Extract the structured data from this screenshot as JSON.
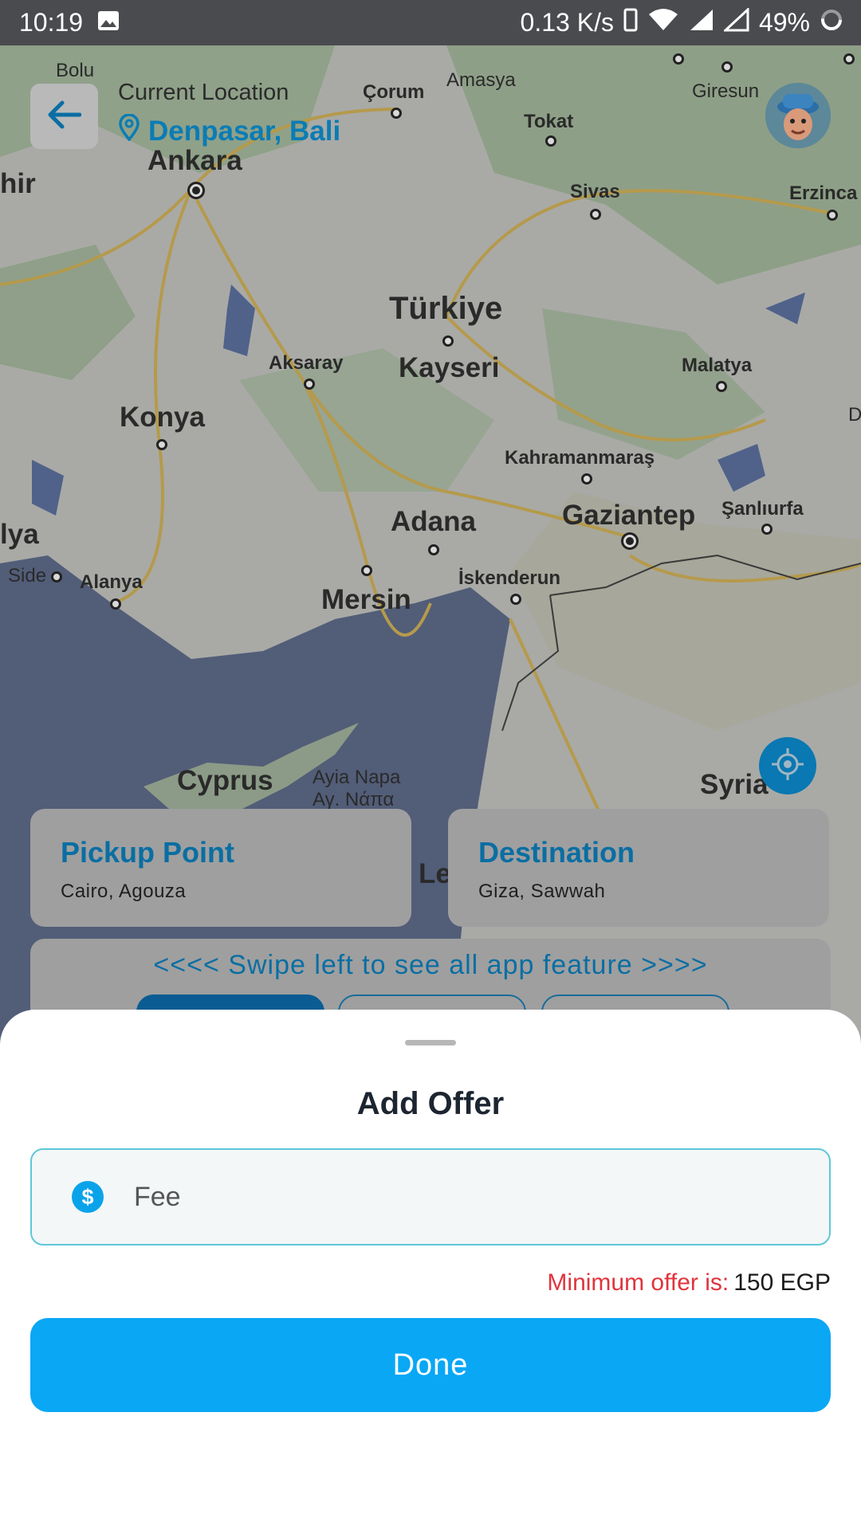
{
  "status_bar": {
    "time": "10:19",
    "network_speed": "0.13 K/s",
    "battery": "49%"
  },
  "header": {
    "location_title": "Current Location",
    "location_value": "Denpasar, Bali"
  },
  "map": {
    "labels": {
      "bolu": "Bolu",
      "amasya": "Amasya",
      "corum": "Çorum",
      "giresun": "Giresun",
      "tokat": "Tokat",
      "ankara": "Ankara",
      "hir": "hir",
      "sivas": "Sivas",
      "erzinca": "Erzinca",
      "turkiye": "Türkiye",
      "aksaray": "Aksaray",
      "kayseri": "Kayseri",
      "malatya": "Malatya",
      "konya": "Konya",
      "d": "D",
      "kahramanmaras": "Kahramanmaraş",
      "sanliurfa": "Şanlıurfa",
      "alya": "lya",
      "adana": "Adana",
      "gaziantep": "Gaziantep",
      "side": "Side",
      "alanya": "Alanya",
      "iskenderun": "İskenderun",
      "mersin": "Mersin",
      "cyprus": "Cyprus",
      "ayia_napa": "Ayia Napa",
      "ay_napa": "Αγ. Νάπα",
      "syria": "Syria",
      "le": "Le"
    }
  },
  "cards": {
    "pickup": {
      "title": "Pickup Point",
      "value": "Cairo, Agouza"
    },
    "destination": {
      "title": "Destination",
      "value": "Giza, Sawwah"
    }
  },
  "features": {
    "hint": "<<<< Swipe left to see all app feature >>>>"
  },
  "sheet": {
    "title": "Add Offer",
    "fee_placeholder": "Fee",
    "fee_icon": "$",
    "min_offer_label": "Minimum offer is:",
    "min_offer_value": "150 EGP",
    "done_label": "Done"
  },
  "colors": {
    "accent": "#0aa7f5",
    "error": "#e0343c",
    "title": "#1c2530"
  }
}
